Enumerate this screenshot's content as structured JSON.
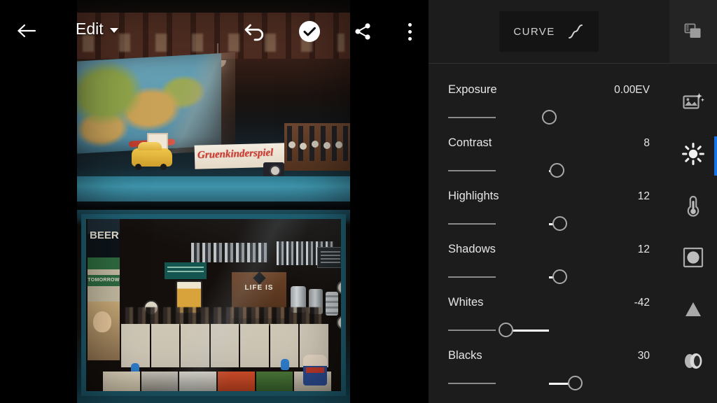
{
  "app": {
    "name": "Photo Editor",
    "accent_color": "#1473e6",
    "panel_bg": "#1c1c1c",
    "rail_bg": "#1c1c1c",
    "text_color": "#e6e6e6"
  },
  "toolbar": {
    "back_icon": "back-arrow-icon",
    "title": "Edit",
    "title_caret_icon": "chevron-down-icon",
    "undo_icon": "undo-icon",
    "confirm_icon": "check-circle-icon",
    "share_icon": "share-icon",
    "more_icon": "more-vertical-icon"
  },
  "panel": {
    "curve_button": {
      "label": "CURVE",
      "icon": "tone-curve-icon"
    },
    "sliders": [
      {
        "label": "Exposure",
        "value": "0.00EV",
        "position": 50,
        "fill_from": 50,
        "fill_to": 50,
        "name": "exposure"
      },
      {
        "label": "Contrast",
        "value": "8",
        "position": 54,
        "fill_from": 50,
        "fill_to": 54,
        "name": "contrast"
      },
      {
        "label": "Highlights",
        "value": "12",
        "position": 55.5,
        "fill_from": 50,
        "fill_to": 55.5,
        "name": "highlights"
      },
      {
        "label": "Shadows",
        "value": "12",
        "position": 55.5,
        "fill_from": 50,
        "fill_to": 55.5,
        "name": "shadows"
      },
      {
        "label": "Whites",
        "value": "-42",
        "position": 28.5,
        "fill_from": 28.5,
        "fill_to": 50,
        "name": "whites"
      },
      {
        "label": "Blacks",
        "value": "30",
        "position": 63,
        "fill_from": 50,
        "fill_to": 63,
        "name": "blacks"
      }
    ]
  },
  "rail": {
    "top_item": {
      "icon": "layers-copy-icon",
      "name": "versions"
    },
    "items": [
      {
        "icon": "auto-enhance-icon",
        "name": "auto-enhance",
        "active": false
      },
      {
        "icon": "brightness-icon",
        "name": "light",
        "active": true
      },
      {
        "icon": "thermometer-icon",
        "name": "color",
        "active": false
      },
      {
        "icon": "vignette-icon",
        "name": "effects",
        "active": false
      },
      {
        "icon": "triangle-icon",
        "name": "detail",
        "active": false
      },
      {
        "icon": "lens-blur-icon",
        "name": "optics",
        "active": false
      }
    ]
  },
  "photo": {
    "description": "Shop window display photograph",
    "top_scene": {
      "sign_text": "Gruenkinderspiel",
      "alt": "window with world map, yellow toy car, watches rack"
    },
    "bottom_scene": {
      "beer_text": "BEER",
      "tomorrow_text": "TOMORROW",
      "life_text": "LIFE IS",
      "alt": "window with vintage posters, books, photographs, flasks"
    }
  }
}
